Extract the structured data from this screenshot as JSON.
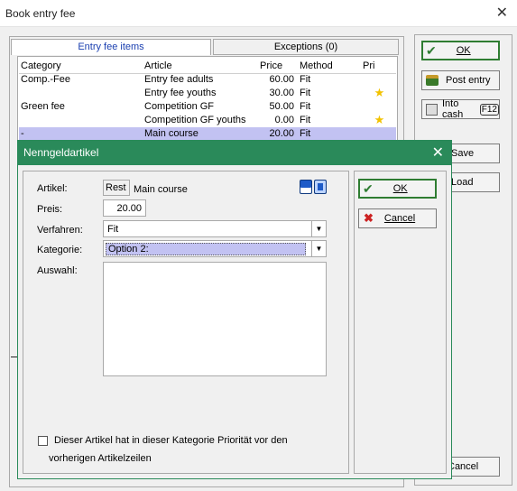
{
  "outer": {
    "title": "Book entry fee",
    "close": "✕",
    "tabs": [
      "Entry fee items",
      "Exceptions (0)"
    ],
    "columns": [
      "Category",
      "Article",
      "Price",
      "Method",
      "Pri"
    ],
    "rows": [
      {
        "category": "Comp.-Fee",
        "article": "Entry fee adults",
        "price": "60.00",
        "method": "Fit",
        "pri": ""
      },
      {
        "category": "",
        "article": "Entry fee youths",
        "price": "30.00",
        "method": "Fit",
        "pri": "★"
      },
      {
        "category": "Green fee",
        "article": "Competition GF",
        "price": "50.00",
        "method": "Fit",
        "pri": ""
      },
      {
        "category": "",
        "article": "Competition GF youths",
        "price": "0.00",
        "method": "Fit",
        "pri": "★"
      },
      {
        "category": "-",
        "article": "Main course",
        "price": "20.00",
        "method": "Fit",
        "pri": ""
      }
    ],
    "buttons": {
      "ok": "OK",
      "post_entry": "Post entry",
      "into_cash": "Into cash",
      "into_cash_key": "F12",
      "save": "Save",
      "load": "Load",
      "cancel": "Cancel"
    }
  },
  "dialog": {
    "title": "Nenngeldartikel",
    "close": "✕",
    "labels": {
      "artikel": "Artikel:",
      "preis": "Preis:",
      "verfahren": "Verfahren:",
      "kategorie": "Kategorie:",
      "auswahl": "Auswahl:"
    },
    "artikel_code": "Rest",
    "artikel_name": "Main course",
    "preis": "20.00",
    "verfahren": "Fit",
    "kategorie": "Option 2:",
    "checkbox_text_1": "Dieser Artikel hat in dieser Kategorie Priorität vor den",
    "checkbox_text_2": "vorherigen Artikelzeilen",
    "ok": "OK",
    "cancel": "Cancel"
  },
  "colors": {
    "accent_green": "#2a8a5a",
    "selection": "#c2c2f2",
    "ok_check": "#2f7d32",
    "cancel_x": "#cc2222",
    "star": "#f2c200"
  }
}
